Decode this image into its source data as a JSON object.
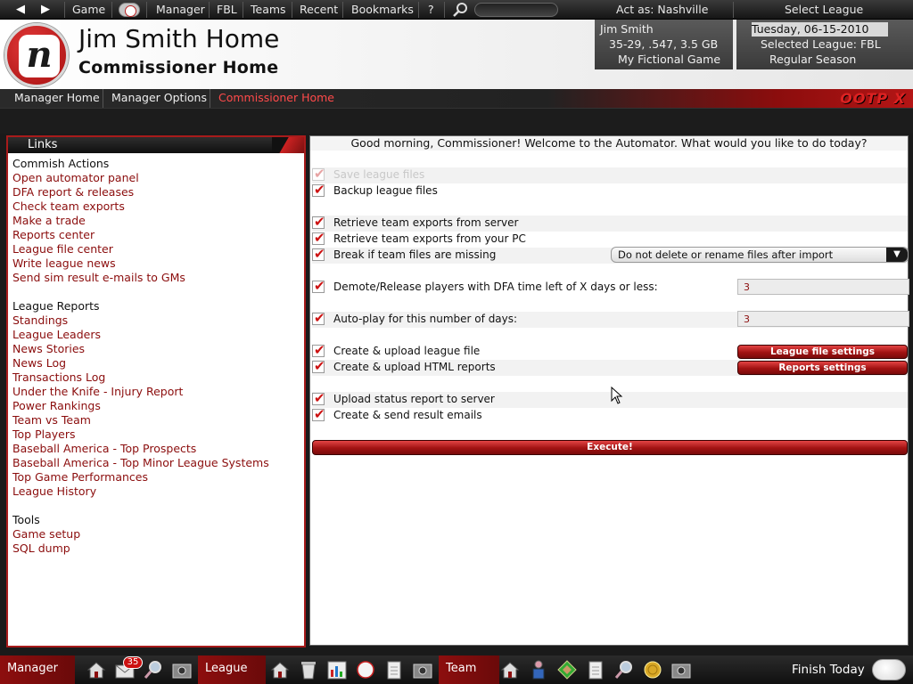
{
  "topbar": {
    "back": "◀",
    "forward": "▶",
    "items": [
      "Game",
      "Manager",
      "FBL",
      "Teams",
      "Recent",
      "Bookmarks",
      "?"
    ],
    "act_as": "Act as: Nashville",
    "select_league": "Select League"
  },
  "header": {
    "title": "Jim Smith Home",
    "subtitle": "Commissioner Home",
    "logo_letter": "n",
    "user": {
      "name": "Jim Smith",
      "record": "35-29, .547, 3.5 GB",
      "game": "My Fictional Game"
    },
    "league": {
      "date": "Tuesday, 06-15-2010",
      "selected": "Selected League: FBL",
      "season": "Regular Season"
    }
  },
  "tabs": [
    "Manager Home",
    "Manager Options",
    "Commissioner Home"
  ],
  "brand": "OOTP X",
  "links": {
    "title": "Links",
    "sections": [
      {
        "heading": "Commish Actions",
        "items": [
          "Open automator panel",
          "DFA report & releases",
          "Check team exports",
          "Make a trade",
          "Reports center",
          "League file center",
          "Write league news",
          "Send sim result e-mails to GMs"
        ]
      },
      {
        "heading": "League Reports",
        "items": [
          "Standings",
          "League Leaders",
          "News Stories",
          "News Log",
          "Transactions Log",
          "Under the Knife - Injury Report",
          "Power Rankings",
          "Team vs Team",
          "Top Players",
          "Baseball America - Top Prospects",
          "Baseball America - Top Minor League Systems",
          "Top Game Performances",
          "League History"
        ]
      },
      {
        "heading": "Tools",
        "items": [
          "Game setup",
          "SQL dump"
        ]
      }
    ]
  },
  "automator": {
    "welcome": "Good morning, Commissioner! Welcome to the Automator. What would you like to do today?",
    "save_files": "Save league files",
    "backup_files": "Backup league files",
    "retrieve_server": "Retrieve team exports from server",
    "retrieve_pc": "Retrieve team exports from your PC",
    "break_missing": "Break if team files are missing",
    "import_option": "Do not delete or rename files after import",
    "demote_release": "Demote/Release players with DFA time left of X days or less:",
    "dfa_days": "3",
    "auto_play": "Auto-play for this number of days:",
    "auto_play_days": "3",
    "create_league_file": "Create & upload league file",
    "league_file_settings": "League file settings",
    "create_html": "Create & upload HTML reports",
    "reports_settings": "Reports settings",
    "upload_status": "Upload status report to server",
    "send_emails": "Create & send result emails",
    "execute": "Execute!"
  },
  "bottombar": {
    "manager": "Manager",
    "mail_count": "35",
    "league": "League",
    "team": "Team",
    "finish": "Finish Today"
  },
  "colors": {
    "accent": "#8b0d0d",
    "bar": "#1a1a1a"
  }
}
